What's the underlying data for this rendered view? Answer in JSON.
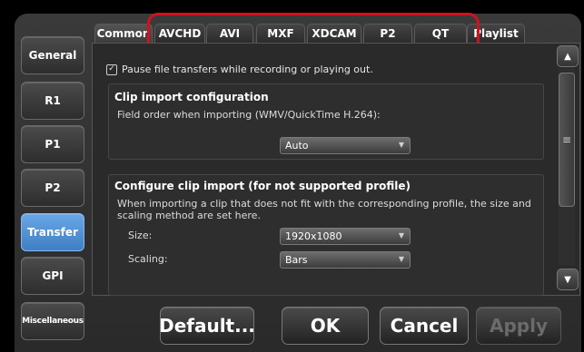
{
  "sidebar": {
    "items": [
      {
        "label": "General"
      },
      {
        "label": "R1"
      },
      {
        "label": "P1"
      },
      {
        "label": "P2"
      },
      {
        "label": "Transfer"
      },
      {
        "label": "GPI"
      },
      {
        "label": "Miscellaneous"
      }
    ],
    "active_index": 4,
    "active_color": "#4a8fd6"
  },
  "tabs": [
    {
      "label": "Common"
    },
    {
      "label": "AVCHD"
    },
    {
      "label": "AVI"
    },
    {
      "label": "MXF"
    },
    {
      "label": "XDCAM"
    },
    {
      "label": "P2"
    },
    {
      "label": "QT"
    },
    {
      "label": "Playlist"
    }
  ],
  "highlight_color": "#d0121c",
  "content": {
    "pause_checkbox": {
      "label": "Pause file transfers while recording or playing out.",
      "checked": true
    },
    "clip_import": {
      "title": "Clip import configuration",
      "field_order_label": "Field order when importing (WMV/QuickTime H.264):",
      "field_order_value": "Auto"
    },
    "unsupported": {
      "title": "Configure clip import (for not supported profile)",
      "description": "When importing a clip that does not fit with the corresponding profile, the size and scaling method are set here.",
      "size_label": "Size:",
      "size_value": "1920x1080",
      "scaling_label": "Scaling:",
      "scaling_value": "Bars"
    }
  },
  "footer": {
    "default_label": "Default...",
    "ok_label": "OK",
    "cancel_label": "Cancel",
    "apply_label": "Apply"
  }
}
